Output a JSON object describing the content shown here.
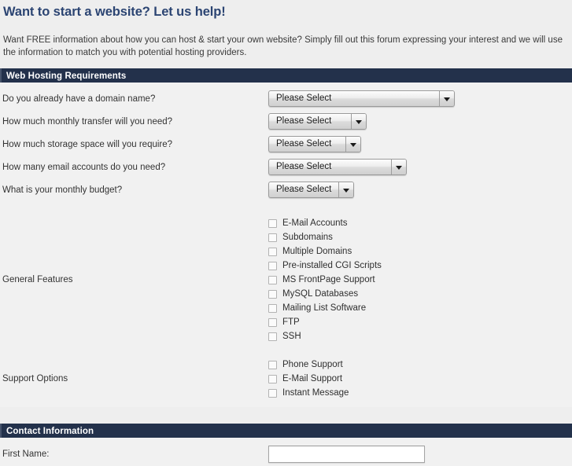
{
  "page": {
    "title": "Want to start a website? Let us help!",
    "intro": "Want FREE information about how you can host & start your own website? Simply fill out this forum expressing your interest and we will use the information to match you with potential hosting providers.",
    "title_color": "#2b4472",
    "bar_color": "#23314b",
    "body_bg": "#f1f1f1"
  },
  "sections": {
    "requirements": {
      "header": "Web Hosting Requirements",
      "selects": [
        {
          "label": "Do you already have a domain name?",
          "value": "Please Select",
          "width": "w-1"
        },
        {
          "label": "How much monthly transfer will you need?",
          "value": "Please Select",
          "width": "w-2"
        },
        {
          "label": "How much storage space will you require?",
          "value": "Please Select",
          "width": "w-3"
        },
        {
          "label": "How many email accounts do you need?",
          "value": "Please Select",
          "width": "w-4"
        },
        {
          "label": "What is your monthly budget?",
          "value": "Please Select",
          "width": "w-5"
        }
      ],
      "general_features": {
        "label": "General Features",
        "options": [
          "E-Mail Accounts",
          "Subdomains",
          "Multiple Domains",
          "Pre-installed CGI Scripts",
          "MS FrontPage Support",
          "MySQL Databases",
          "Mailing List Software",
          "FTP",
          "SSH"
        ]
      },
      "support_options": {
        "label": "Support Options",
        "options": [
          "Phone Support",
          "E-Mail Support",
          "Instant Message"
        ]
      }
    },
    "contact": {
      "header": "Contact Information",
      "first_name": {
        "label": "First Name:",
        "value": "",
        "placeholder": ""
      }
    }
  }
}
